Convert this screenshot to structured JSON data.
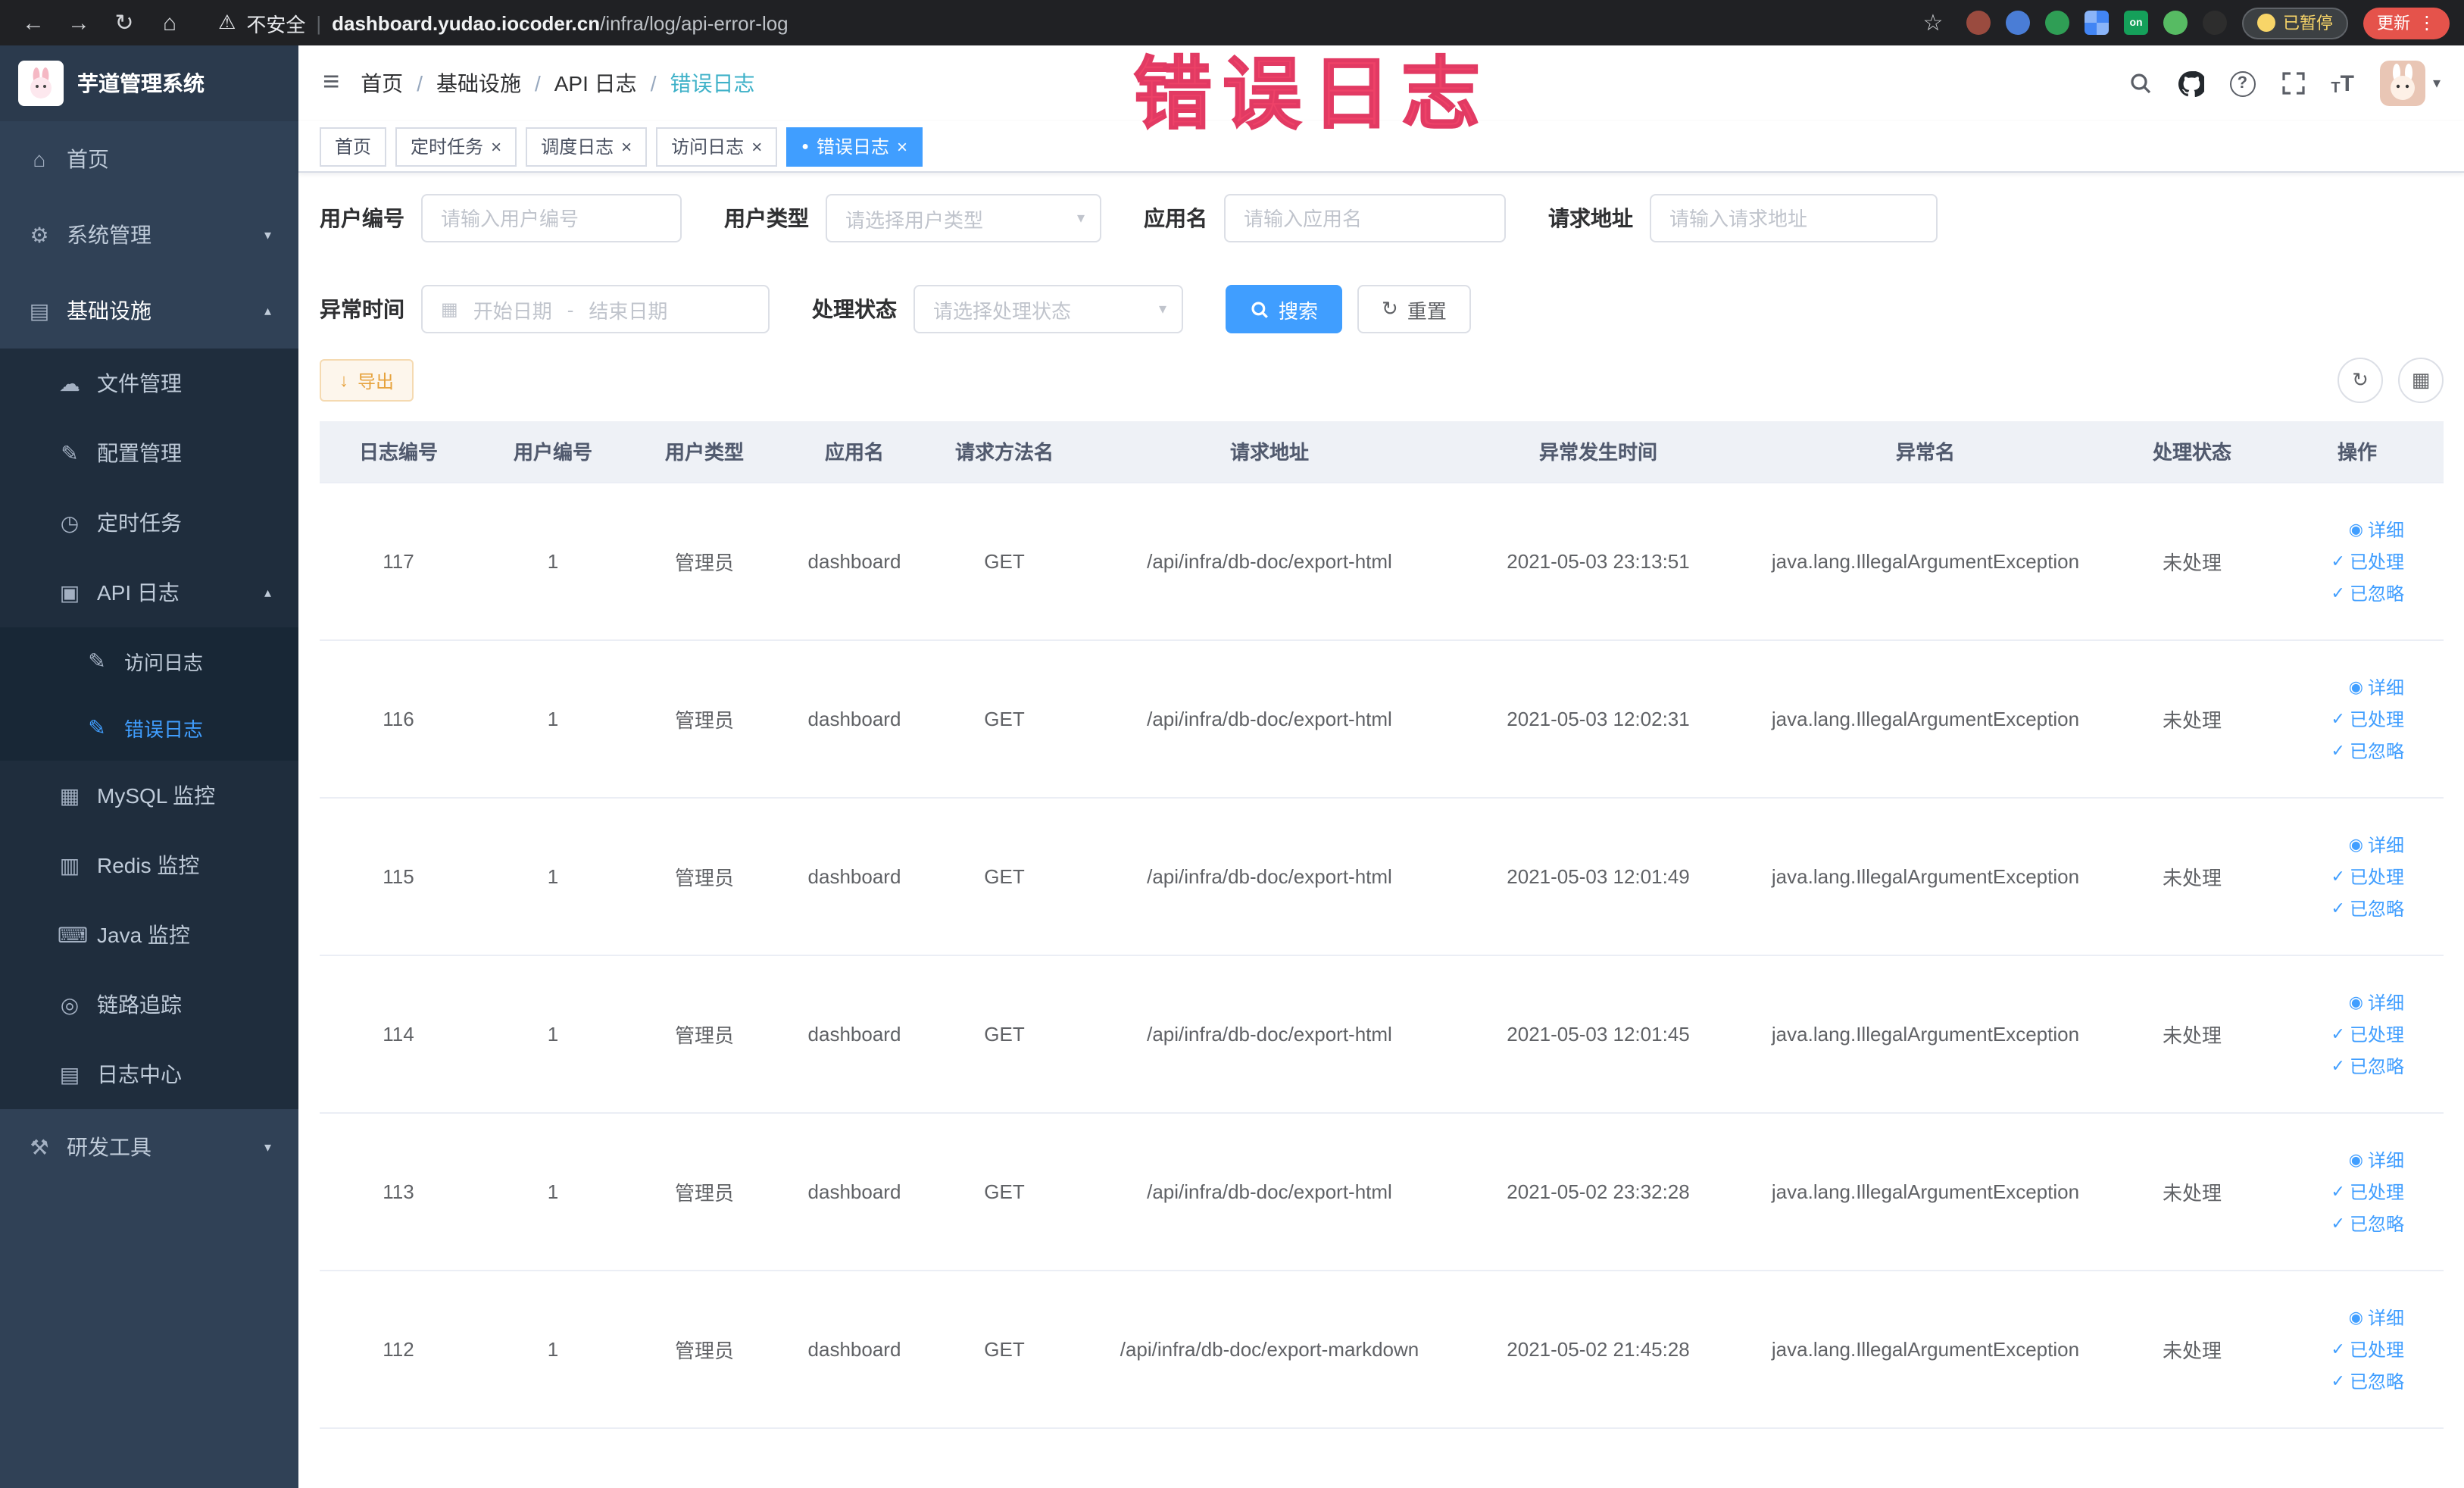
{
  "icons": {
    "back": "←",
    "forward": "→",
    "reload": "↻",
    "home": "⌂",
    "warning": "⚠",
    "star": "☆",
    "menu_dots": "⋮",
    "hamburger": "≡",
    "chevron_down": "▾",
    "chevron_up": "▴",
    "close": "×",
    "active_dot": "●",
    "calendar": "▦",
    "select_arrow": "▾",
    "reset": "↻",
    "download": "↓",
    "refresh": "↻",
    "columns": "▦",
    "eye": "◉",
    "check": "✓",
    "question": "?",
    "caret_down": "▾",
    "font_size": "T",
    "menu_home": "⌂",
    "menu_system": "⚙",
    "menu_infra": "▤",
    "menu_file": "☁",
    "menu_config": "✎",
    "menu_job": "◷",
    "menu_api": "▣",
    "menu_access": "✎",
    "menu_error": "✎",
    "menu_mysql": "▦",
    "menu_redis": "▥",
    "menu_java": "⌨",
    "menu_trace": "◎",
    "menu_logcenter": "▤",
    "menu_tools": "⚒"
  },
  "browser": {
    "security_label": "不安全",
    "separator": "|",
    "url_domain": "dashboard.yudao.iocoder.cn",
    "url_path": "/infra/log/api-error-log",
    "extension_on_badge": "on",
    "paused_label": "已暂停",
    "update_label": "更新"
  },
  "sidebar": {
    "logo_title": "芋道管理系统",
    "items": [
      {
        "label": "首页"
      },
      {
        "label": "系统管理"
      },
      {
        "label": "基础设施"
      },
      {
        "label": "文件管理"
      },
      {
        "label": "配置管理"
      },
      {
        "label": "定时任务"
      },
      {
        "label": "API 日志"
      },
      {
        "label": "访问日志"
      },
      {
        "label": "错误日志"
      },
      {
        "label": "MySQL 监控"
      },
      {
        "label": "Redis 监控"
      },
      {
        "label": "Java 监控"
      },
      {
        "label": "链路追踪"
      },
      {
        "label": "日志中心"
      },
      {
        "label": "研发工具"
      }
    ]
  },
  "header": {
    "breadcrumb": [
      "首页",
      "基础设施",
      "API 日志",
      "错误日志"
    ],
    "breadcrumb_separator": "/"
  },
  "annotation": {
    "text": "错误日志"
  },
  "tabs": [
    {
      "label": "首页"
    },
    {
      "label": "定时任务"
    },
    {
      "label": "调度日志"
    },
    {
      "label": "访问日志"
    },
    {
      "label": "错误日志"
    }
  ],
  "filters": {
    "user_id_label": "用户编号",
    "user_id_placeholder": "请输入用户编号",
    "user_type_label": "用户类型",
    "user_type_placeholder": "请选择用户类型",
    "app_name_label": "应用名",
    "app_name_placeholder": "请输入应用名",
    "request_url_label": "请求地址",
    "request_url_placeholder": "请输入请求地址",
    "exception_time_label": "异常时间",
    "start_placeholder": "开始日期",
    "date_separator": "-",
    "end_placeholder": "结束日期",
    "process_status_label": "处理状态",
    "process_status_placeholder": "请选择处理状态",
    "search_label": "搜索",
    "reset_label": "重置"
  },
  "toolbar": {
    "export_label": "导出"
  },
  "table": {
    "columns": [
      "日志编号",
      "用户编号",
      "用户类型",
      "应用名",
      "请求方法名",
      "请求地址",
      "异常发生时间",
      "异常名",
      "处理状态",
      "操作"
    ],
    "rows": [
      [
        "117",
        "1",
        "管理员",
        "dashboard",
        "GET",
        "/api/infra/db-doc/export-html",
        "2021-05-03 23:13:51",
        "java.lang.IllegalArgumentException",
        "未处理"
      ],
      [
        "116",
        "1",
        "管理员",
        "dashboard",
        "GET",
        "/api/infra/db-doc/export-html",
        "2021-05-03 12:02:31",
        "java.lang.IllegalArgumentException",
        "未处理"
      ],
      [
        "115",
        "1",
        "管理员",
        "dashboard",
        "GET",
        "/api/infra/db-doc/export-html",
        "2021-05-03 12:01:49",
        "java.lang.IllegalArgumentException",
        "未处理"
      ],
      [
        "114",
        "1",
        "管理员",
        "dashboard",
        "GET",
        "/api/infra/db-doc/export-html",
        "2021-05-03 12:01:45",
        "java.lang.IllegalArgumentException",
        "未处理"
      ],
      [
        "113",
        "1",
        "管理员",
        "dashboard",
        "GET",
        "/api/infra/db-doc/export-html",
        "2021-05-02 23:32:28",
        "java.lang.IllegalArgumentException",
        "未处理"
      ],
      [
        "112",
        "1",
        "管理员",
        "dashboard",
        "GET",
        "/api/infra/db-doc/export-markdown",
        "2021-05-02 21:45:28",
        "java.lang.IllegalArgumentException",
        "未处理"
      ]
    ],
    "actions": {
      "detail": "详细",
      "processed": "已处理",
      "ignored": "已忽略"
    }
  }
}
